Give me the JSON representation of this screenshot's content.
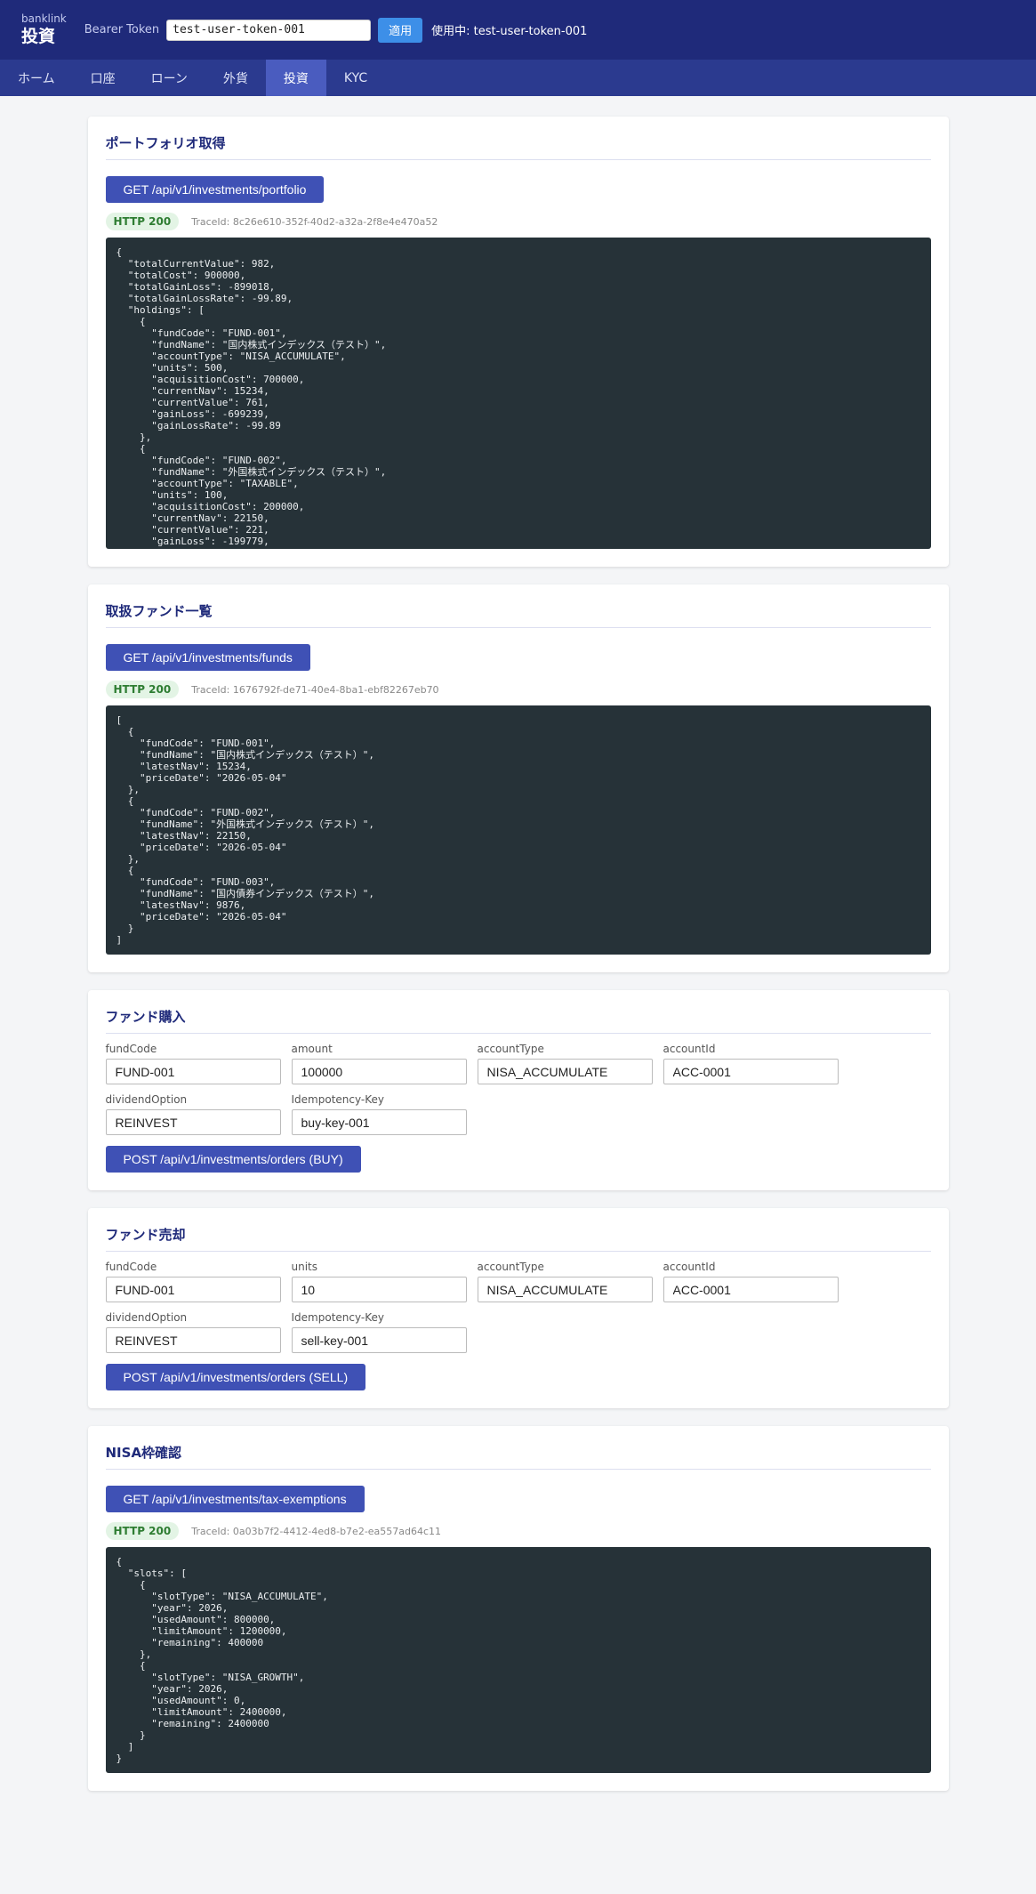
{
  "header": {
    "brand": "banklink",
    "page_title": "投資",
    "token_label": "Bearer Token",
    "token_value": "test-user-token-001",
    "apply_label": "適用",
    "using_text": "使用中: test-user-token-001"
  },
  "nav": {
    "items": [
      {
        "label": "ホーム"
      },
      {
        "label": "口座"
      },
      {
        "label": "ローン"
      },
      {
        "label": "外貨"
      },
      {
        "label": "投資",
        "active": true
      },
      {
        "label": "KYC"
      }
    ]
  },
  "portfolio": {
    "title": "ポートフォリオ取得",
    "button": "GET /api/v1/investments/portfolio",
    "status": "HTTP 200",
    "trace": "TraceId: 8c26e610-352f-40d2-a32a-2f8e4e470a52",
    "response": "{\n  \"totalCurrentValue\": 982,\n  \"totalCost\": 900000,\n  \"totalGainLoss\": -899018,\n  \"totalGainLossRate\": -99.89,\n  \"holdings\": [\n    {\n      \"fundCode\": \"FUND-001\",\n      \"fundName\": \"国内株式インデックス（テスト）\",\n      \"accountType\": \"NISA_ACCUMULATE\",\n      \"units\": 500,\n      \"acquisitionCost\": 700000,\n      \"currentNav\": 15234,\n      \"currentValue\": 761,\n      \"gainLoss\": -699239,\n      \"gainLossRate\": -99.89\n    },\n    {\n      \"fundCode\": \"FUND-002\",\n      \"fundName\": \"外国株式インデックス（テスト）\",\n      \"accountType\": \"TAXABLE\",\n      \"units\": 100,\n      \"acquisitionCost\": 200000,\n      \"currentNav\": 22150,\n      \"currentValue\": 221,\n      \"gainLoss\": -199779,"
  },
  "funds": {
    "title": "取扱ファンド一覧",
    "button": "GET /api/v1/investments/funds",
    "status": "HTTP 200",
    "trace": "TraceId: 1676792f-de71-40e4-8ba1-ebf82267eb70",
    "response": "[\n  {\n    \"fundCode\": \"FUND-001\",\n    \"fundName\": \"国内株式インデックス（テスト）\",\n    \"latestNav\": 15234,\n    \"priceDate\": \"2026-05-04\"\n  },\n  {\n    \"fundCode\": \"FUND-002\",\n    \"fundName\": \"外国株式インデックス（テスト）\",\n    \"latestNav\": 22150,\n    \"priceDate\": \"2026-05-04\"\n  },\n  {\n    \"fundCode\": \"FUND-003\",\n    \"fundName\": \"国内債券インデックス（テスト）\",\n    \"latestNav\": 9876,\n    \"priceDate\": \"2026-05-04\"\n  }\n]"
  },
  "buy": {
    "title": "ファンド購入",
    "fields": [
      {
        "label": "fundCode",
        "value": "FUND-001"
      },
      {
        "label": "amount",
        "value": "100000"
      },
      {
        "label": "accountType",
        "value": "NISA_ACCUMULATE"
      },
      {
        "label": "accountId",
        "value": "ACC-0001"
      },
      {
        "label": "dividendOption",
        "value": "REINVEST"
      },
      {
        "label": "Idempotency-Key",
        "value": "buy-key-001"
      }
    ],
    "button": "POST /api/v1/investments/orders (BUY)"
  },
  "sell": {
    "title": "ファンド売却",
    "fields": [
      {
        "label": "fundCode",
        "value": "FUND-001"
      },
      {
        "label": "units",
        "value": "10"
      },
      {
        "label": "accountType",
        "value": "NISA_ACCUMULATE"
      },
      {
        "label": "accountId",
        "value": "ACC-0001"
      },
      {
        "label": "dividendOption",
        "value": "REINVEST"
      },
      {
        "label": "Idempotency-Key",
        "value": "sell-key-001"
      }
    ],
    "button": "POST /api/v1/investments/orders (SELL)"
  },
  "nisa": {
    "title": "NISA枠確認",
    "button": "GET /api/v1/investments/tax-exemptions",
    "status": "HTTP 200",
    "trace": "TraceId: 0a03b7f2-4412-4ed8-b7e2-ea557ad64c11",
    "response": "{\n  \"slots\": [\n    {\n      \"slotType\": \"NISA_ACCUMULATE\",\n      \"year\": 2026,\n      \"usedAmount\": 800000,\n      \"limitAmount\": 1200000,\n      \"remaining\": 400000\n    },\n    {\n      \"slotType\": \"NISA_GROWTH\",\n      \"year\": 2026,\n      \"usedAmount\": 0,\n      \"limitAmount\": 2400000,\n      \"remaining\": 2400000\n    }\n  ]\n}"
  },
  "colors": {
    "header_bg": "#1f2a7a",
    "nav_bg": "#2b3a8f",
    "nav_active": "#4a5cbf",
    "primary_button": "#3f51b5",
    "apply_button": "#3d8fe8",
    "code_bg": "#263238",
    "success_badge": "#2e7d32"
  }
}
